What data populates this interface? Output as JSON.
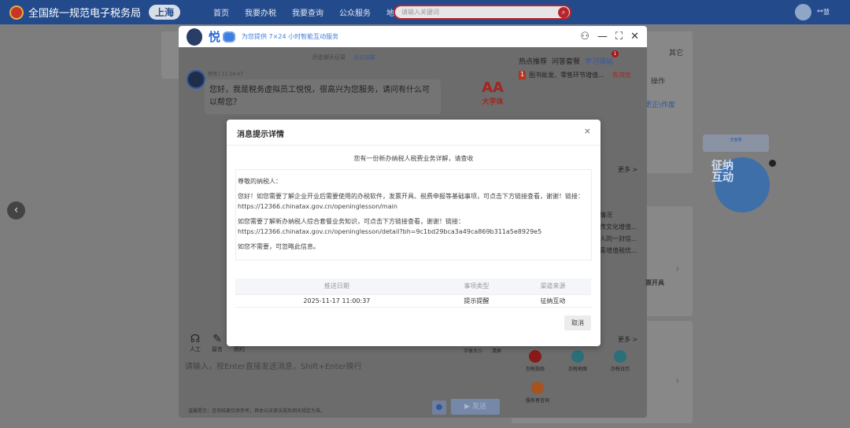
{
  "nav": {
    "site_title": "全国统一规范电子税务局",
    "city": "上海",
    "menu": [
      "首页",
      "我要办税",
      "我要查询",
      "公众服务",
      "地方特色"
    ],
    "search_placeholder": "请输入关键词",
    "user": "**慧"
  },
  "page": {
    "right_tab": "其它",
    "op": "操作",
    "link": "更正\\作废",
    "more": "更多 >",
    "list": [
      "情况",
      "传文化增值...",
      "人的一封信...",
      "青增值税优..."
    ],
    "invoice": "票开具",
    "quick": [
      "办税指南",
      "办税地图",
      "办税日历",
      "服务者咨询"
    ],
    "float_text": "征纳互动",
    "float_tip": "全面版"
  },
  "chat": {
    "name": "悦",
    "slogan": "为您提供 7×24 小时智能互动服务",
    "history": "历史聊天记录",
    "load": "点击加载",
    "sender": "悦悦 | 11:14:47",
    "greeting": "您好，我是税务虚拟员工悦悦，很高兴为您服务，请问有什么可以帮您？",
    "big_font": "大字体",
    "tabs": [
      "热点推荐",
      "问答套餐",
      "学习驿站"
    ],
    "badge": "1",
    "hot_num": "1",
    "hot_item": "图书批发、零售环节增值...",
    "hot_go": "去浏览",
    "tools": [
      "人工",
      "留言",
      "预约"
    ],
    "opts": [
      "字体大小",
      "清屏"
    ],
    "input_placeholder": "请输入，按Enter直接发送消息，Shift+Enter换行",
    "tip": "温馨提示：咨询结果仅供参考，具体以法律法规及相关规定为准。",
    "send": "▶ 发送"
  },
  "modal": {
    "title": "消息提示详情",
    "subtitle": "您有一份新办纳税人税费业务详解，请查收",
    "greeting": "尊敬的纳税人：",
    "p1": "您好！如您需要了解企业开业后需要使用的办税软件，发票开具、税费申报等基础事项，可点击下方链接查看，谢谢！链接：",
    "url1": "https://12366.chinatax.gov.cn/openinglesson/main",
    "p2": "如您需要了解新办纳税人综合套餐业务知识，可点击下方链接查看，谢谢！链接：",
    "url2": "https://12366.chinatax.gov.cn/openinglesson/detail?bh=9c1bd29bca3a49ca869b311a5e8929e5",
    "p3": "如您不需要，可忽略此信息。",
    "columns": [
      "推送日期",
      "事项类型",
      "渠道来源"
    ],
    "row": [
      "2025-11-17 11:00:37",
      "提示提醒",
      "征纳互动"
    ],
    "cancel": "取消"
  }
}
